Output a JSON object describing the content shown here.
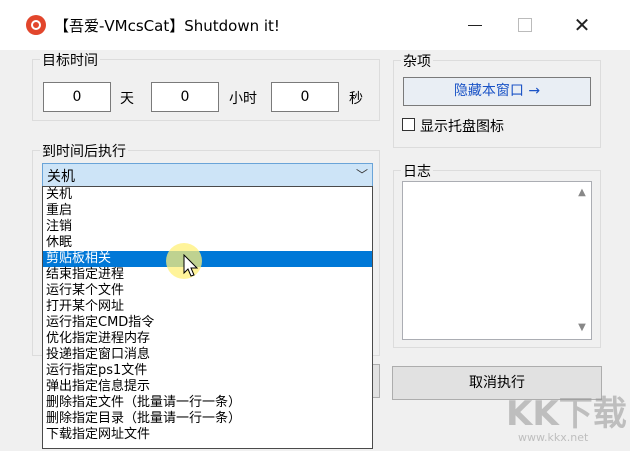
{
  "window": {
    "title": "【吾爱-VMcsCat】Shutdown it!",
    "minimize_glyph": "—",
    "maximize_glyph": "□",
    "close_glyph": "✕"
  },
  "target_time": {
    "legend": "目标时间",
    "days_value": "0",
    "days_unit": "天",
    "hours_value": "0",
    "hours_unit": "小时",
    "seconds_value": "0",
    "seconds_unit": "秒"
  },
  "misc": {
    "legend": "杂项",
    "hide_window_label": "隐藏本窗口 →",
    "tray_icon_label": "显示托盘图标",
    "tray_icon_checked": false
  },
  "action": {
    "legend": "到时间后执行",
    "selected": "关机",
    "options": [
      "关机",
      "重启",
      "注销",
      "休眠",
      "剪贴板相关",
      "结束指定进程",
      "运行某个文件",
      "打开某个网址",
      "运行指定CMD指令",
      "优化指定进程内存",
      "投递指定窗口消息",
      "运行指定ps1文件",
      "弹出指定信息提示",
      "删除指定文件（批量请一行一条）",
      "删除指定目录（批量请一行一条）",
      "下载指定网址文件"
    ],
    "highlighted_index": 4
  },
  "log": {
    "legend": "日志",
    "content": ""
  },
  "buttons": {
    "cancel_label": "取消执行"
  },
  "watermark": {
    "text": "KK下载",
    "url": "www.kkx.net"
  }
}
